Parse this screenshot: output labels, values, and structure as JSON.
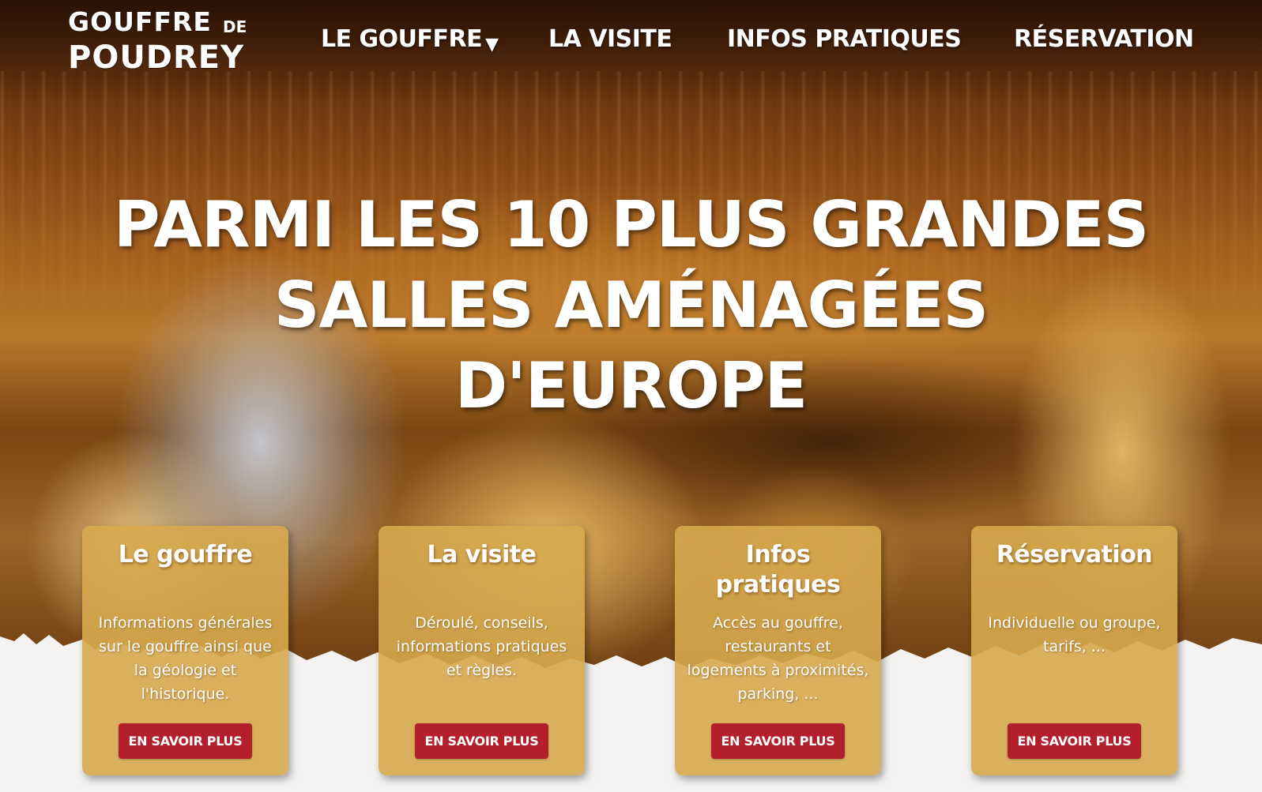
{
  "logo": {
    "line1": "GOUFFRE",
    "de": "DE",
    "line2": "POUDREY"
  },
  "nav": {
    "items": [
      {
        "label": "LE GOUFFRE",
        "has_dropdown": true
      },
      {
        "label": "LA VISITE"
      },
      {
        "label": "INFOS PRATIQUES"
      },
      {
        "label": "RÉSERVATION"
      }
    ],
    "caret_glyph": "▼"
  },
  "hero": {
    "headline_line1": "PARMI LES 10 PLUS GRANDES",
    "headline_line2": "SALLES AMÉNAGÉES",
    "headline_line3": "D'EUROPE"
  },
  "cards": [
    {
      "title": "Le gouffre",
      "text": "Informations générales sur le gouffre ainsi que la géologie et l'historique.",
      "button": "EN SAVOIR PLUS"
    },
    {
      "title": "La visite",
      "text": "Déroulé, conseils, informations pratiques et règles.",
      "button": "EN SAVOIR PLUS"
    },
    {
      "title": "Infos pratiques",
      "text": "Accès au gouffre, restaurants et logements à proximités, parking, ...",
      "button": "EN SAVOIR PLUS"
    },
    {
      "title": "Réservation",
      "text": "Individuelle ou groupe, tarifs, ...",
      "button": "EN SAVOIR PLUS"
    }
  ],
  "colors": {
    "card_bg": "#d6a84e",
    "button_bg": "#b3202b",
    "page_bg": "#f4f3f1",
    "text": "#ffffff"
  }
}
